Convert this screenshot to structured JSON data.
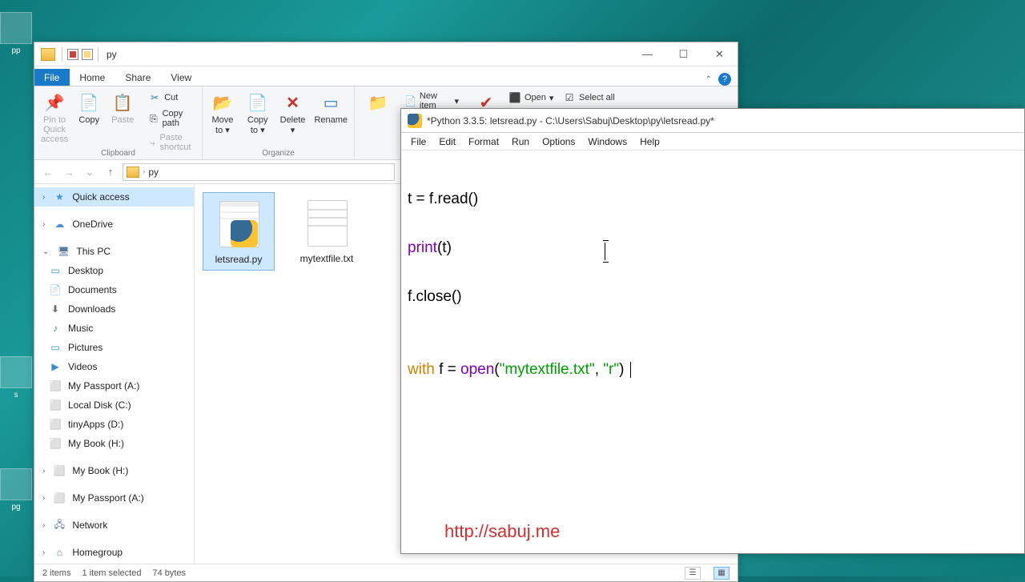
{
  "desktop": {
    "i1": "pp",
    "i2": "s",
    "i3": "pg"
  },
  "explorer": {
    "title": "py",
    "tabs": {
      "file": "File",
      "home": "Home",
      "share": "Share",
      "view": "View"
    },
    "ribbon": {
      "clipboard": {
        "label": "Clipboard",
        "pin": "Pin to Quick access",
        "copy": "Copy",
        "paste": "Paste",
        "cut": "Cut",
        "copypath": "Copy path",
        "pasteshort": "Paste shortcut"
      },
      "organize": {
        "label": "Organize",
        "moveto": "Move to",
        "copyto": "Copy to",
        "delete": "Delete",
        "rename": "Rename"
      },
      "new": {
        "newitem": "New item"
      },
      "open": {
        "open": "Open"
      },
      "select": {
        "selectall": "Select all"
      }
    },
    "breadcrumb": {
      "folder": "py"
    },
    "sidebar": {
      "quick": "Quick access",
      "onedrive": "OneDrive",
      "thispc": "This PC",
      "desktop": "Desktop",
      "documents": "Documents",
      "downloads": "Downloads",
      "music": "Music",
      "pictures": "Pictures",
      "videos": "Videos",
      "passportA": "My Passport (A:)",
      "localC": "Local Disk (C:)",
      "tinyD": "tinyApps (D:)",
      "bookH": "My Book (H:)",
      "bookH2": "My Book (H:)",
      "passportA2": "My Passport (A:)",
      "network": "Network",
      "homegroup": "Homegroup"
    },
    "files": {
      "letsread": "letsread.py",
      "mytext": "mytextfile.txt"
    },
    "status": {
      "items": "2 items",
      "selected": "1 item selected",
      "size": "74 bytes"
    }
  },
  "idle": {
    "title": "*Python 3.3.5: letsread.py - C:\\Users\\Sabuj\\Desktop\\py\\letsread.py*",
    "menu": {
      "file": "File",
      "edit": "Edit",
      "format": "Format",
      "run": "Run",
      "options": "Options",
      "windows": "Windows",
      "help": "Help"
    },
    "code": {
      "l1_a": "t = f.read()",
      "l2_print": "print",
      "l2_rest": "(t)",
      "l3_a": "f.close()",
      "l4_with": "with",
      "l4_mid": " f = ",
      "l4_open": "open",
      "l4_p1": "(",
      "l4_s1": "\"mytextfile.txt\"",
      "l4_c": ", ",
      "l4_s2": "\"r\"",
      "l4_p2": ") "
    }
  },
  "watermark": "http://sabuj.me"
}
